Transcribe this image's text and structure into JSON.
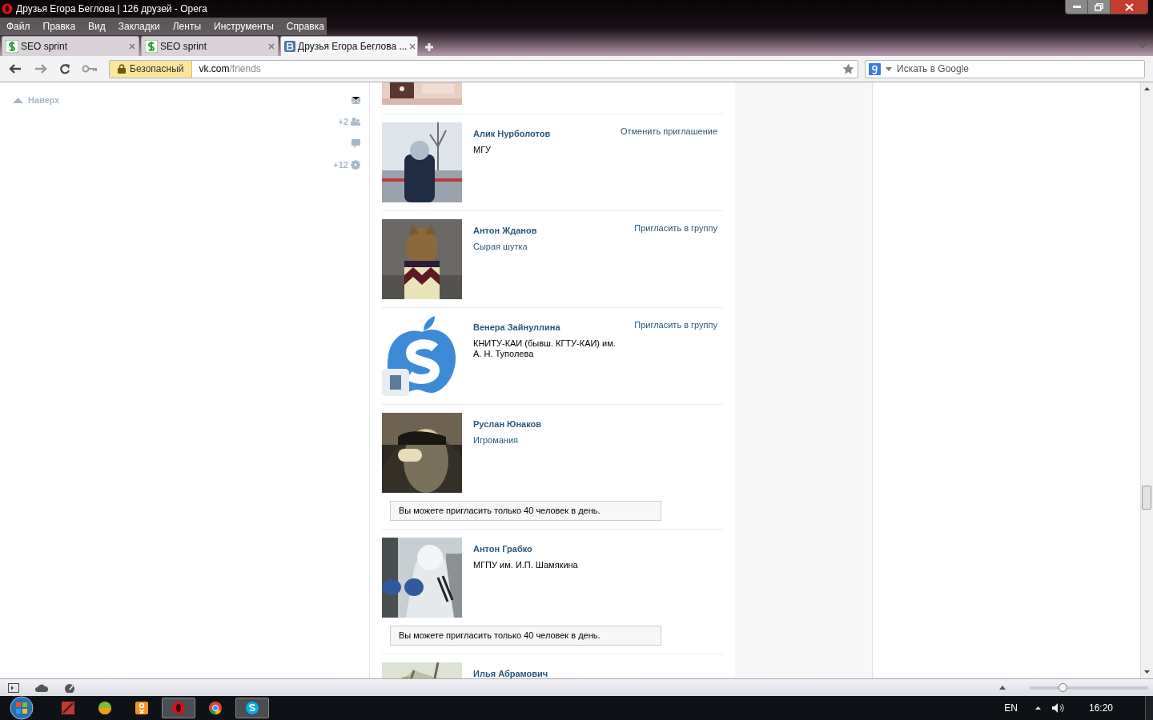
{
  "window": {
    "title": "Друзья Егора Беглова | 126 друзей - Opera"
  },
  "menu": [
    "Файл",
    "Правка",
    "Вид",
    "Закладки",
    "Ленты",
    "Инструменты",
    "Справка"
  ],
  "tabs": [
    {
      "label": "SEO sprint",
      "kind": "seo",
      "selected": false
    },
    {
      "label": "SEO sprint",
      "kind": "seo",
      "selected": false
    },
    {
      "label": "Друзья Егора Беглова ...",
      "kind": "vk",
      "selected": true
    }
  ],
  "address": {
    "security": "Безопасный",
    "host": "vk.com",
    "path": "/friends"
  },
  "search": {
    "placeholder": "Искать в Google"
  },
  "sidebar": {
    "up_link": "Наверх",
    "counters": [
      {
        "kind": "mail"
      },
      {
        "kind": "friends",
        "count": "+2"
      },
      {
        "kind": "comment"
      },
      {
        "kind": "settings",
        "count": "+12"
      }
    ]
  },
  "friends": [
    {
      "name": "Алик Нурболотов",
      "info": "МГУ",
      "info_link": false,
      "action": "Отменить приглашение"
    },
    {
      "name": "Антон Жданов",
      "info": "Сырая шутка",
      "info_link": true,
      "action": "Пригласить в группу"
    },
    {
      "name": "Венера Зайнуллина",
      "info": "КНИТУ-КАИ (бывш. КГТУ-КАИ) им. А. Н. Туполева",
      "info_link": false,
      "action": "Пригласить в группу"
    },
    {
      "name": "Руслан Юнаков",
      "info": "Игромания",
      "info_link": true,
      "notice": "Вы можете пригласить только 40 человек в день."
    },
    {
      "name": "Антон Грабко",
      "info": "МГПУ им. И.П. Шамякина",
      "info_link": false,
      "notice": "Вы можете пригласить только 40 человек в день."
    },
    {
      "name": "Илья Абрамович"
    }
  ],
  "status_bar": {
    "zoom_slider": {
      "level": 0.28
    }
  },
  "taskbar": {
    "language": "EN",
    "clock": "16:20"
  }
}
